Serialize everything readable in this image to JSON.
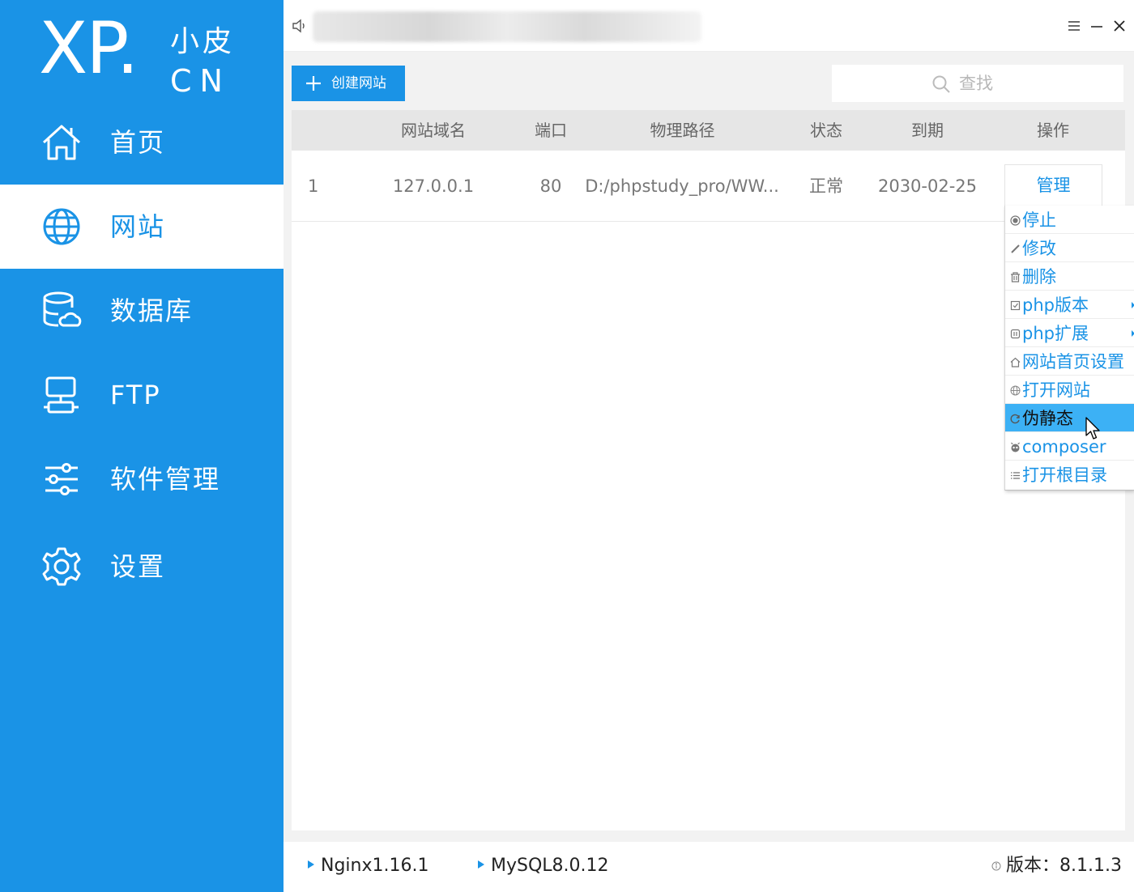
{
  "logo": {
    "main": "XP.",
    "cn_top": "小皮",
    "cn_bottom": "CN"
  },
  "sidebar": {
    "items": [
      {
        "label": "首页",
        "icon": "home-icon",
        "active": false
      },
      {
        "label": "网站",
        "icon": "globe-icon",
        "active": true
      },
      {
        "label": "数据库",
        "icon": "database-icon",
        "active": false
      },
      {
        "label": "FTP",
        "icon": "ftp-server-icon",
        "active": false
      },
      {
        "label": "软件管理",
        "icon": "sliders-icon",
        "active": false
      },
      {
        "label": "设置",
        "icon": "gear-icon",
        "active": false
      }
    ]
  },
  "titlebar": {
    "icons": [
      "speaker-icon",
      "menu-icon",
      "minimize-icon",
      "close-icon"
    ]
  },
  "toolbar": {
    "create_label": "创建网站",
    "search_placeholder": "查找"
  },
  "table": {
    "headers": [
      "网站域名",
      "端口",
      "物理路径",
      "状态",
      "到期",
      "操作"
    ],
    "rows": [
      {
        "index": "1",
        "domain": "127.0.0.1",
        "port": "80",
        "path": "D:/phpstudy_pro/WW...",
        "status": "正常",
        "expire": "2030-02-25",
        "action": "管理"
      }
    ]
  },
  "dropdown": {
    "items": [
      {
        "label": "停止",
        "icon": "stop-icon"
      },
      {
        "label": "修改",
        "icon": "pencil-icon"
      },
      {
        "label": "删除",
        "icon": "trash-icon"
      },
      {
        "label": "php版本",
        "icon": "php-version-icon",
        "submenu": true
      },
      {
        "label": "php扩展",
        "icon": "php-extension-icon",
        "submenu": true
      },
      {
        "label": "网站首页设置",
        "icon": "home-icon"
      },
      {
        "label": "打开网站",
        "icon": "globe-icon"
      },
      {
        "label": "伪静态",
        "icon": "rewrite-icon",
        "highlighted": true
      },
      {
        "label": "composer",
        "icon": "composer-icon"
      },
      {
        "label": "打开根目录",
        "icon": "list-icon"
      }
    ]
  },
  "statusbar": {
    "nginx": "Nginx1.16.1",
    "mysql": "MySQL8.0.12",
    "version_label": "版本：",
    "version": "8.1.1.3"
  },
  "colors": {
    "accent": "#1a93e6",
    "highlight": "#3cb1f5",
    "panel_bg": "#f2f2f2",
    "header_bg": "#e6e6e6"
  }
}
